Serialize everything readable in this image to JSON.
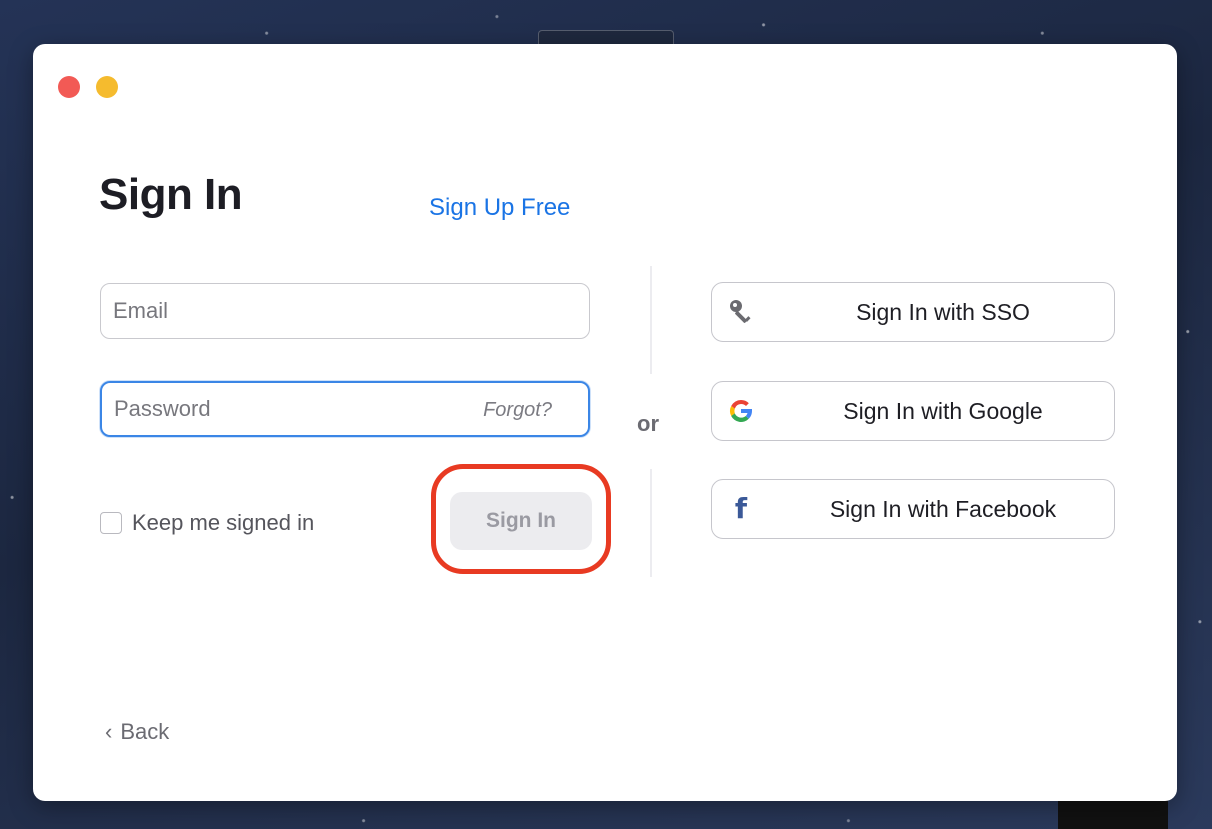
{
  "window": {
    "controls": [
      "close",
      "minimize"
    ]
  },
  "header": {
    "title": "Sign In",
    "signup_link": "Sign Up Free"
  },
  "form": {
    "email": {
      "placeholder": "Email",
      "value": ""
    },
    "password": {
      "placeholder": "Password",
      "value": "",
      "forgot_label": "Forgot?"
    },
    "keep_signed_in": {
      "label": "Keep me signed in",
      "checked": false
    },
    "submit_label": "Sign In"
  },
  "separator": {
    "label": "or"
  },
  "alt_signin": [
    {
      "label": "Sign In with SSO",
      "icon": "key-icon"
    },
    {
      "label": "Sign In with Google",
      "icon": "google-icon"
    },
    {
      "label": "Sign In with Facebook",
      "icon": "facebook-icon"
    }
  ],
  "footer": {
    "back_label": "Back"
  },
  "colors": {
    "accent": "#1a74e5",
    "focus_border": "#3b86e6",
    "highlight_ring": "#e83a22",
    "close": "#f25a55",
    "minimize": "#f5bb2e",
    "facebook": "#3b5998"
  }
}
